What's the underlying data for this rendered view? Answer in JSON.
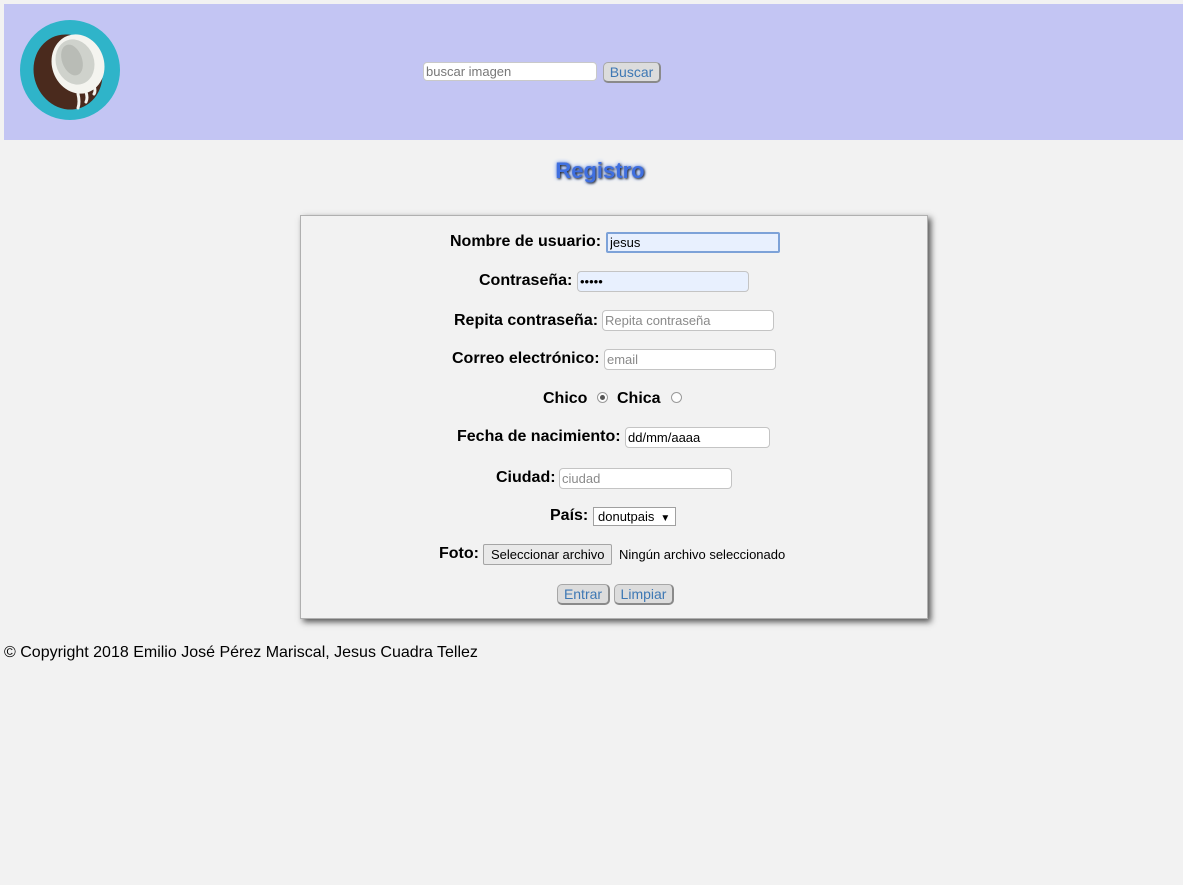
{
  "header": {
    "search": {
      "placeholder": "buscar imagen",
      "value": ""
    },
    "search_button": "Buscar"
  },
  "page_title": "Registro",
  "form": {
    "username": {
      "label": "Nombre de usuario:",
      "value": "jesus"
    },
    "password": {
      "label": "Contraseña:",
      "value": "•••••"
    },
    "repeat_password": {
      "label": "Repita contraseña:",
      "placeholder": "Repita contraseña"
    },
    "email": {
      "label": "Correo electrónico:",
      "placeholder": "email"
    },
    "gender": {
      "options": [
        "Chico",
        "Chica"
      ],
      "selected": "Chico"
    },
    "birthdate": {
      "label": "Fecha de nacimiento:",
      "value": "dd/mm/aaaa"
    },
    "city": {
      "label": "Ciudad:",
      "placeholder": "ciudad"
    },
    "country": {
      "label": "País:",
      "selected": "donutpais"
    },
    "photo": {
      "label": "Foto:",
      "button": "Seleccionar archivo",
      "status": "Ningún archivo seleccionado"
    },
    "submit_button": "Entrar",
    "reset_button": "Limpiar"
  },
  "footer": {
    "copyright": "© Copyright 2018 Emilio José Pérez Mariscal, Jesus Cuadra Tellez"
  },
  "colors": {
    "header_bg": "#c3c5f3",
    "title": "#3f6fe0",
    "button_text": "#3e78b4",
    "logo_ring": "#2fb4c9"
  }
}
